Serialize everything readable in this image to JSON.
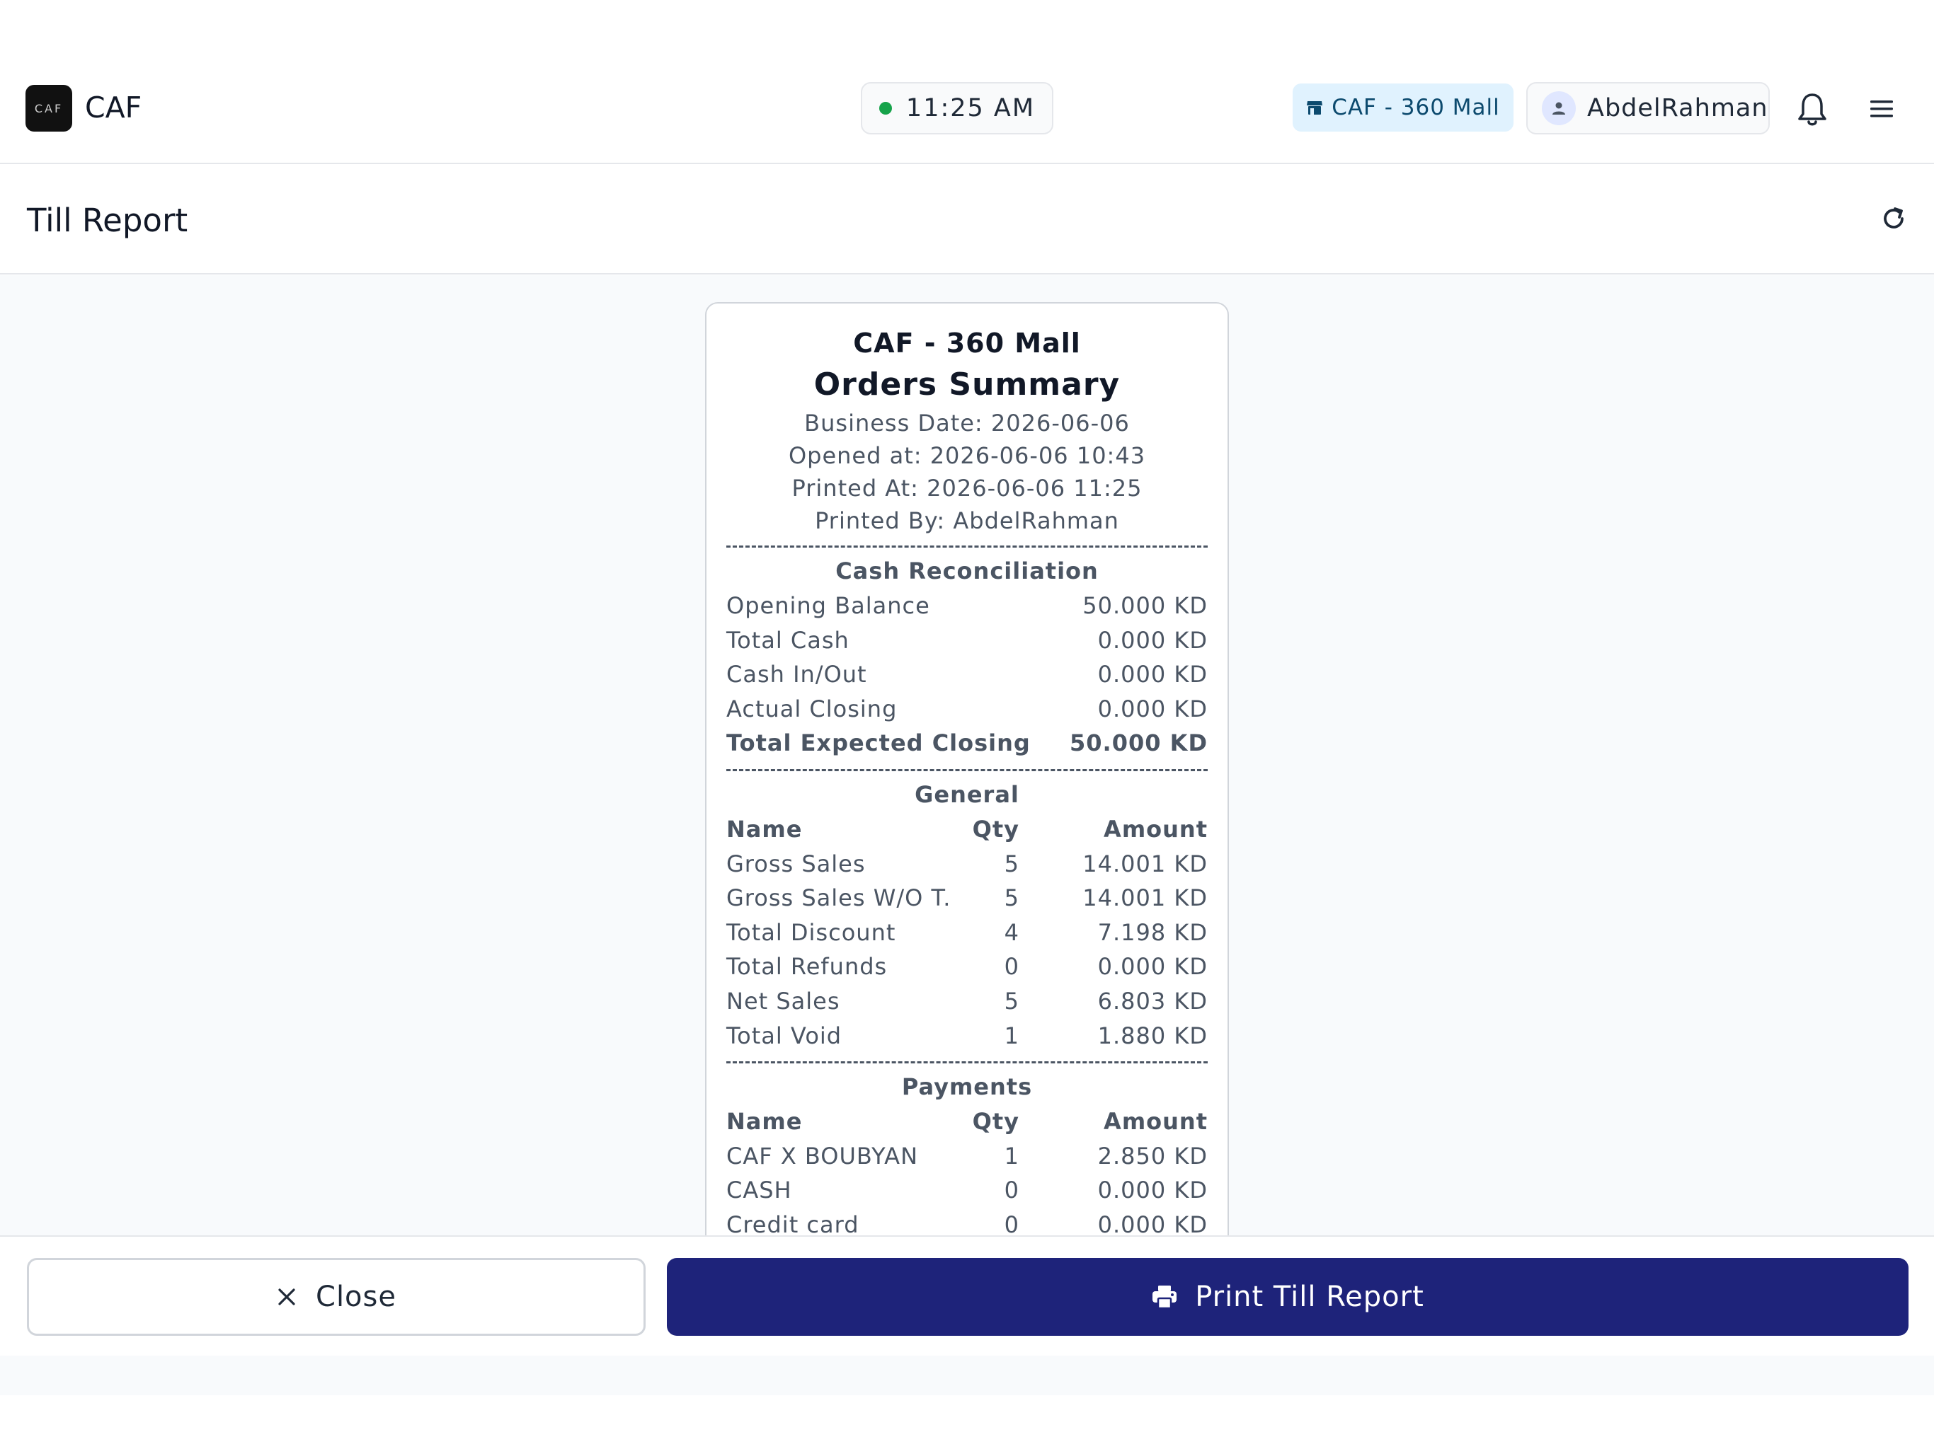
{
  "header": {
    "logo_text": "CAF",
    "app_name": "CAF",
    "clock": "11:25 AM",
    "store": "CAF - 360 Mall",
    "user": "AbdelRahman"
  },
  "page": {
    "title": "Till Report"
  },
  "receipt": {
    "store": "CAF - 360 Mall",
    "title": "Orders Summary",
    "meta": [
      "Business Date: 2026-06-06",
      "Opened at: 2026-06-06 10:43",
      "Printed At: 2026-06-06 11:25",
      "Printed By: AbdelRahman"
    ],
    "cash_reconciliation": {
      "heading": "Cash Reconciliation",
      "rows": [
        {
          "label": "Opening Balance",
          "value": "50.000 KD"
        },
        {
          "label": "Total Cash",
          "value": "0.000 KD"
        },
        {
          "label": "Cash In/Out",
          "value": "0.000 KD"
        },
        {
          "label": "Actual Closing",
          "value": "0.000 KD"
        },
        {
          "label": "Total Expected Closing",
          "value": "50.000 KD"
        }
      ]
    },
    "general": {
      "heading": "General",
      "columns": {
        "name": "Name",
        "qty": "Qty",
        "amount": "Amount"
      },
      "rows": [
        {
          "name": "Gross Sales",
          "qty": "5",
          "amount": "14.001 KD"
        },
        {
          "name": "Gross Sales W/O T.",
          "qty": "5",
          "amount": "14.001 KD"
        },
        {
          "name": "Total Discount",
          "qty": "4",
          "amount": "7.198 KD"
        },
        {
          "name": "Total Refunds",
          "qty": "0",
          "amount": "0.000 KD"
        },
        {
          "name": "Net Sales",
          "qty": "5",
          "amount": "6.803 KD"
        },
        {
          "name": "Total Void",
          "qty": "1",
          "amount": "1.880 KD"
        }
      ]
    },
    "payments": {
      "heading": "Payments",
      "columns": {
        "name": "Name",
        "qty": "Qty",
        "amount": "Amount"
      },
      "rows": [
        {
          "name": "CAF X BOUBYAN",
          "qty": "1",
          "amount": "2.850 KD"
        },
        {
          "name": "CASH",
          "qty": "0",
          "amount": "0.000 KD"
        },
        {
          "name": "Credit card",
          "qty": "0",
          "amount": "0.000 KD"
        }
      ]
    }
  },
  "footer": {
    "close_label": "Close",
    "print_label": "Print Till Report"
  },
  "colors": {
    "primary": "#1e237a",
    "online": "#16a34a",
    "store_pill": "#e0f2fe"
  },
  "icons": [
    "store-icon",
    "user-icon",
    "bell-icon",
    "menu-icon",
    "refresh-icon",
    "close-icon",
    "printer-icon"
  ]
}
